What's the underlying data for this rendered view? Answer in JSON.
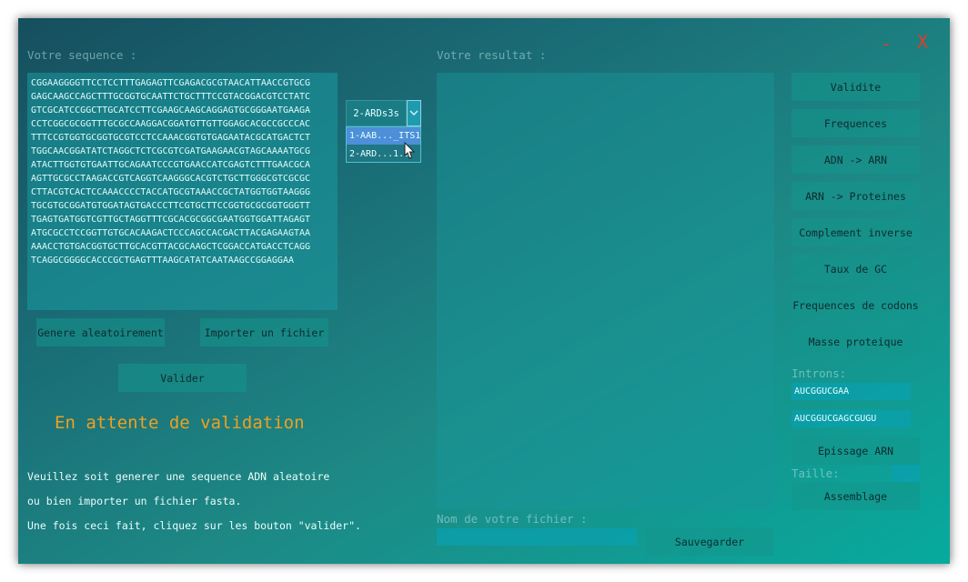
{
  "left": {
    "sequence_label": "Votre sequence :",
    "sequence_lines": [
      "CGGAAGGGGTTCCTCCTTTGAGAGTTCGAGACGCGTAACATTAACCGTGCG",
      "GAGCAAGCCAGCTTTGCGGTGCAATTCTGCTTTCCGTACGGACGTCCTATC",
      "GTCGCATCCGGCTTGCATCCTTCGAAGCAAGCAGGAGTGCGGGAATGAAGA",
      "CCTCGGCGCGGTTTGCGCCAAGGACGGATGTTGTTGGAGCACGCCGCCCAC",
      "TTTCCGTGGTGCGGTGCGTCCTCCAAACGGTGTGAGAATACGCATGACTCT",
      "TGGCAACGGATATCTAGGCTCTCGCGTCGATGAAGAACGTAGCAAAATGCG",
      "ATACTTGGTGTGAATTGCAGAATCCCGTGAACCATCGAGTCTTTGAACGCA",
      "AGTTGCGCCTAAGACCGTCAGGTCAAGGGCACGTCTGCTTGGGCGTCGCGC",
      "CTTACGTCACTCCAAACCCCTACCATGCGTAAACCGCTATGGTGGTAAGGG",
      "TGCGTGCGGATGTGGATAGTGACCCTTCGTGCTTCCGGTGCGCGGTGGGTT",
      "TGAGTGATGGTCGTTGCTAGGTTTCGCACGCGGCGAATGGTGGATTAGAGT",
      "ATGCGCCTCCGGTTGTGCACAAGACTCCCAGCCACGACTTACGAGAAGTAA",
      "AAACCTGTGACGGTGCTTGCACGTTACGCAAGCTCGGACCATGACCTCAGG",
      "TCAGGCGGGGCACCCGCTGAGTTTAAGCATATCAATAAGCCGGAGGAA"
    ],
    "random_button": "Genere aleatoirement",
    "import_button": "Importer un fichier",
    "validate_button": "Valider",
    "status": "En attente de validation",
    "info_lines": [
      "Veuillez soit generer une sequence ADN aleatoire",
      "ou bien importer un fichier fasta.",
      "Une fois ceci fait, cliquez sur les bouton \"valider\"."
    ]
  },
  "combo": {
    "selected": "2-ARDs3s",
    "options": [
      "1-AAB..._ITS1",
      "2-ARD...1.s"
    ],
    "highlighted_index": 0
  },
  "middle": {
    "result_label": "Votre resultat :",
    "filename_label": "Nom de votre fichier :",
    "filename_value": "",
    "save_button": "Sauvegarder"
  },
  "right": {
    "buttons": [
      "Validite",
      "Frequences",
      "ADN -> ARN",
      "ARN -> Proteines",
      "Complement inverse",
      "Taux de GC",
      "Frequences de codons",
      "Masse proteique"
    ],
    "introns_label": "Introns:",
    "intron_values": [
      "AUCGGUCGAA",
      "AUCGGUCGAGCGUGU"
    ],
    "splice_button": "Epissage ARN",
    "size_label": "Taille:",
    "size_value": "",
    "assembly_button": "Assemblage"
  },
  "window": {
    "minimize": "-",
    "close": "X"
  },
  "colors": {
    "status": "#f0a020",
    "close": "#e03c2c",
    "highlight": "#4d8fd8"
  }
}
